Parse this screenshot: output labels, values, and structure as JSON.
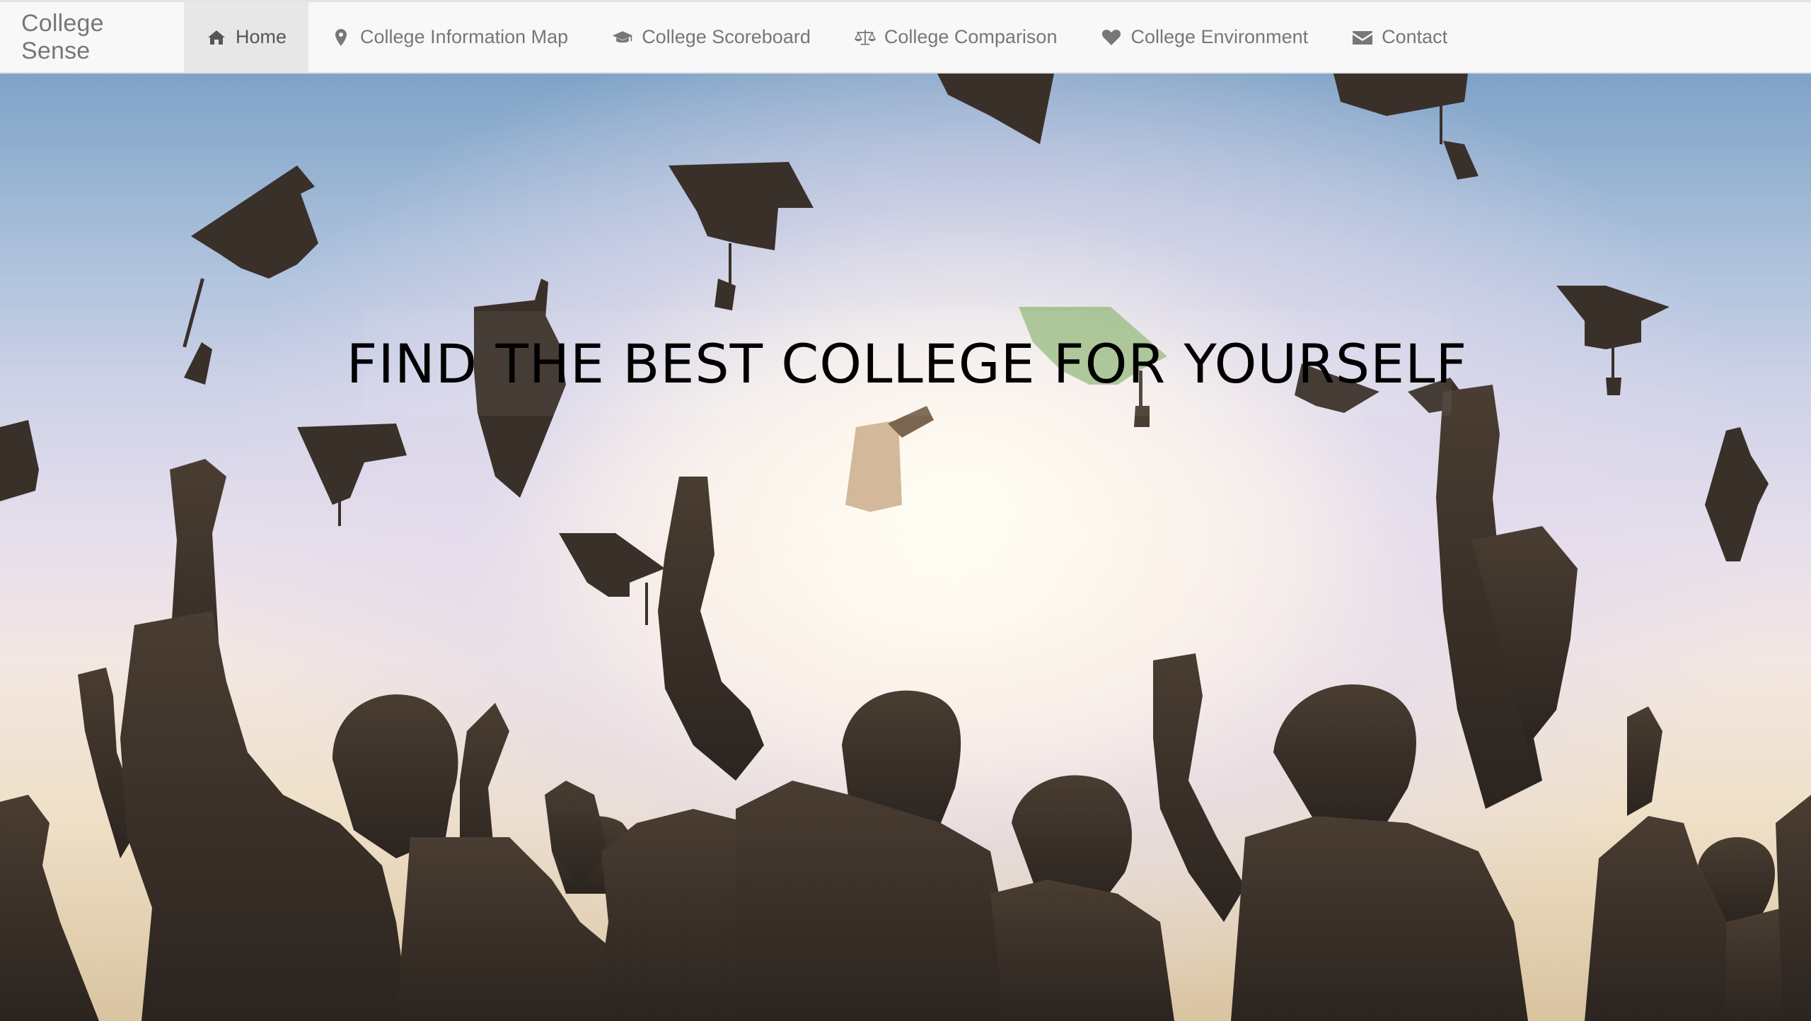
{
  "navbar": {
    "brand": "College Sense",
    "items": [
      {
        "label": "Home",
        "icon": "home-icon",
        "active": true
      },
      {
        "label": "College Information Map",
        "icon": "map-marker-icon",
        "active": false
      },
      {
        "label": "College Scoreboard",
        "icon": "graduation-cap-icon",
        "active": false
      },
      {
        "label": "College Comparison",
        "icon": "balance-scale-icon",
        "active": false
      },
      {
        "label": "College Environment",
        "icon": "heart-icon",
        "active": false
      },
      {
        "label": "Contact",
        "icon": "envelope-icon",
        "active": false
      }
    ],
    "colors": {
      "background": "#f8f8f8",
      "active_background": "#e7e7e7",
      "text": "#777777"
    }
  },
  "hero": {
    "title": "FIND THE BEST COLLEGE FOR YOURSELF",
    "background_image": "graduates-throwing-caps-silhouette"
  }
}
